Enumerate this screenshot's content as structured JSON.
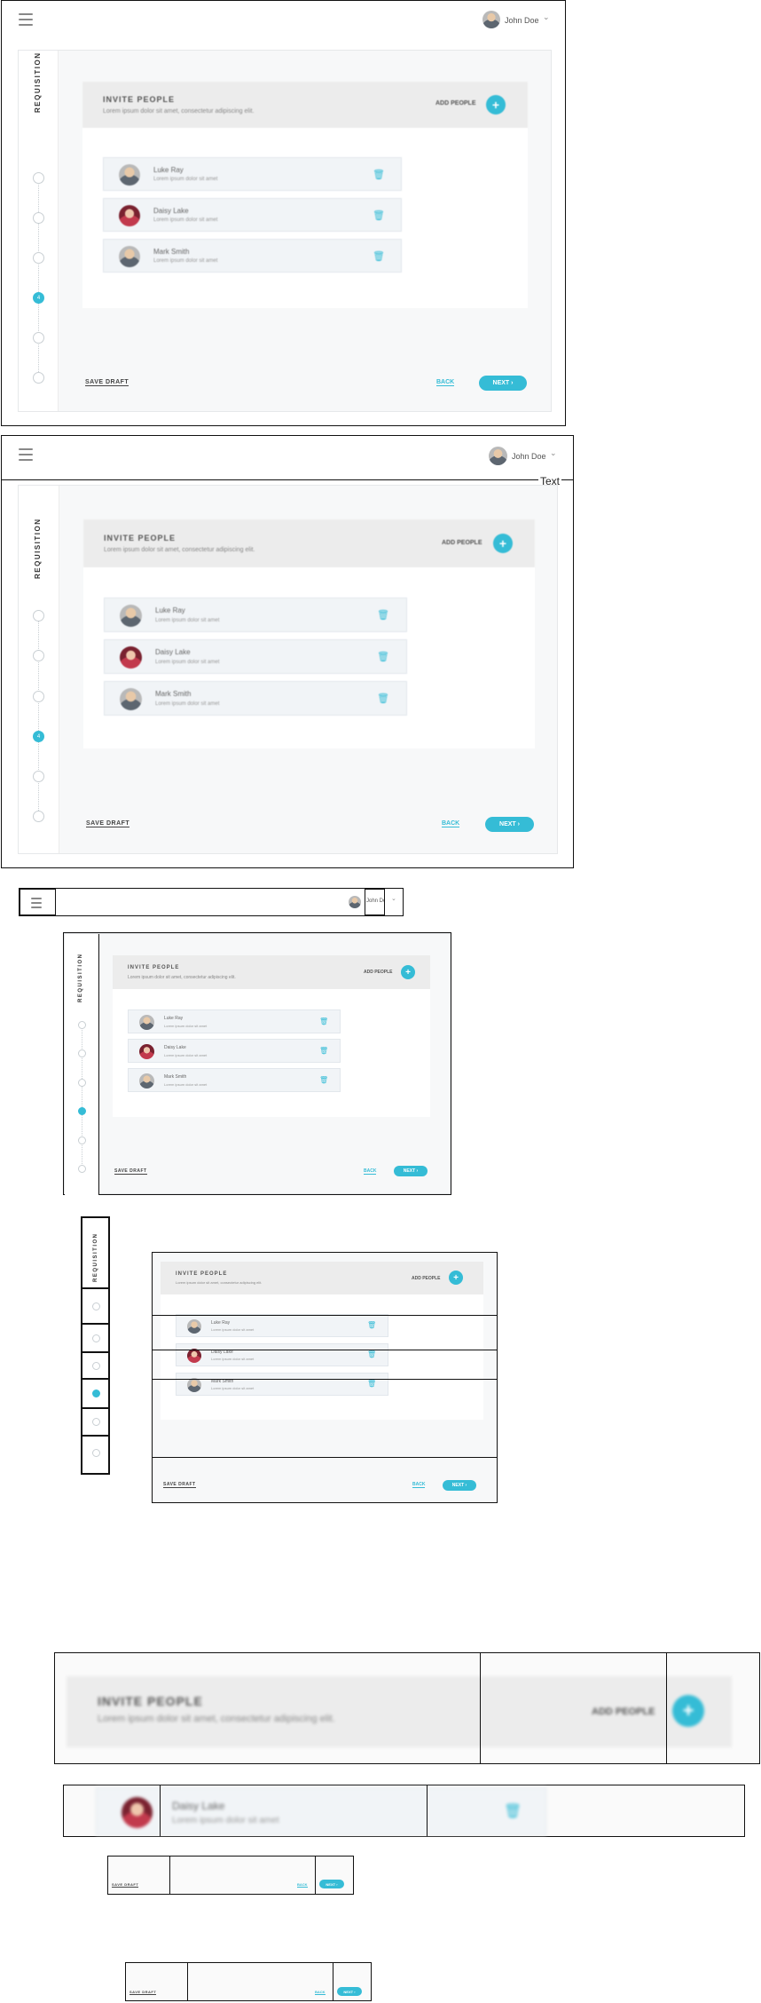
{
  "header": {
    "user_name": "John Doe",
    "chevron": "⌄"
  },
  "sidebar": {
    "title": "REQUISITION",
    "steps": [
      "1",
      "2",
      "3",
      "4",
      "5",
      "6"
    ],
    "active_step": 4
  },
  "invite": {
    "title": "INVITE PEOPLE",
    "subtitle": "Lorem ipsum dolor sit amet, consectetur adipiscing elit.",
    "add_label": "ADD PEOPLE",
    "add_symbol": "+"
  },
  "people": [
    {
      "name": "Luke Ray",
      "desc": "Lorem ipsum dolor sit amet"
    },
    {
      "name": "Daisy Lake",
      "desc": "Lorem ipsum dolor sit amet"
    },
    {
      "name": "Mark Smith",
      "desc": "Lorem ipsum dolor sit amet"
    }
  ],
  "footer": {
    "save_draft": "SAVE DRAFT",
    "back": "BACK",
    "next": "NEXT",
    "next_arrow": "›"
  },
  "annotation": {
    "text": "Text"
  },
  "colors": {
    "accent": "#35bcd6",
    "row_bg": "#f1f4f7",
    "header_bg": "#ececec"
  },
  "icons": [
    "hamburger-icon",
    "chevron-down-icon",
    "plus-icon",
    "trash-icon",
    "arrow-right-icon"
  ]
}
